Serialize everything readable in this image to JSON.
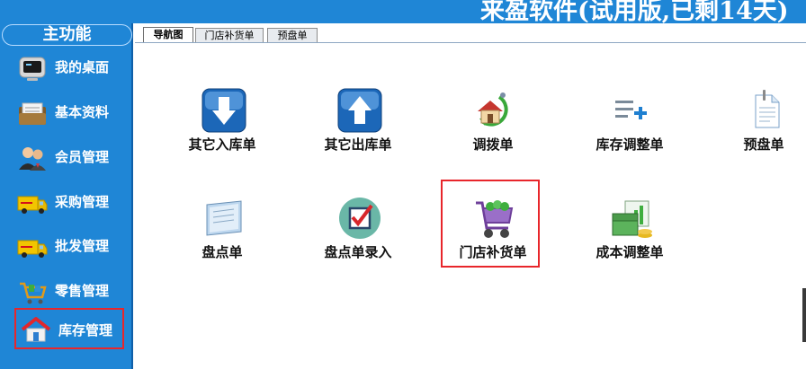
{
  "window": {
    "title": "来盈软件(试用版,已剩14天)"
  },
  "sidebar": {
    "header": "主功能",
    "items": [
      {
        "label": "我的桌面",
        "icon": "monitor-icon"
      },
      {
        "label": "基本资料",
        "icon": "folder-icon"
      },
      {
        "label": "会员管理",
        "icon": "users-icon"
      },
      {
        "label": "采购管理",
        "icon": "truck-icon"
      },
      {
        "label": "批发管理",
        "icon": "truck-icon"
      },
      {
        "label": "零售管理",
        "icon": "shopping-cart-icon"
      },
      {
        "label": "库存管理",
        "icon": "house-icon",
        "highlighted": true
      }
    ]
  },
  "tabs": [
    {
      "label": "导航图",
      "active": true
    },
    {
      "label": "门店补货单",
      "active": false
    },
    {
      "label": "预盘单",
      "active": false
    }
  ],
  "tiles": [
    {
      "label": "其它入库单",
      "icon": "arrow-down-icon"
    },
    {
      "label": "其它出库单",
      "icon": "arrow-up-icon"
    },
    {
      "label": "调拨单",
      "icon": "transfer-house-icon"
    },
    {
      "label": "库存调整单",
      "icon": "list-add-icon"
    },
    {
      "label": "预盘单",
      "icon": "document-icon"
    },
    {
      "label": "盘点单",
      "icon": "clipboard-icon"
    },
    {
      "label": "盘点单录入",
      "icon": "checkbox-icon"
    },
    {
      "label": "门店补货单",
      "icon": "shopping-cart-icon",
      "highlighted": true
    },
    {
      "label": "成本调整单",
      "icon": "money-chart-icon"
    }
  ],
  "colors": {
    "brand_blue": "#1f86d6",
    "highlight_red": "#e8262b",
    "tab_background": "#e8ebef"
  }
}
